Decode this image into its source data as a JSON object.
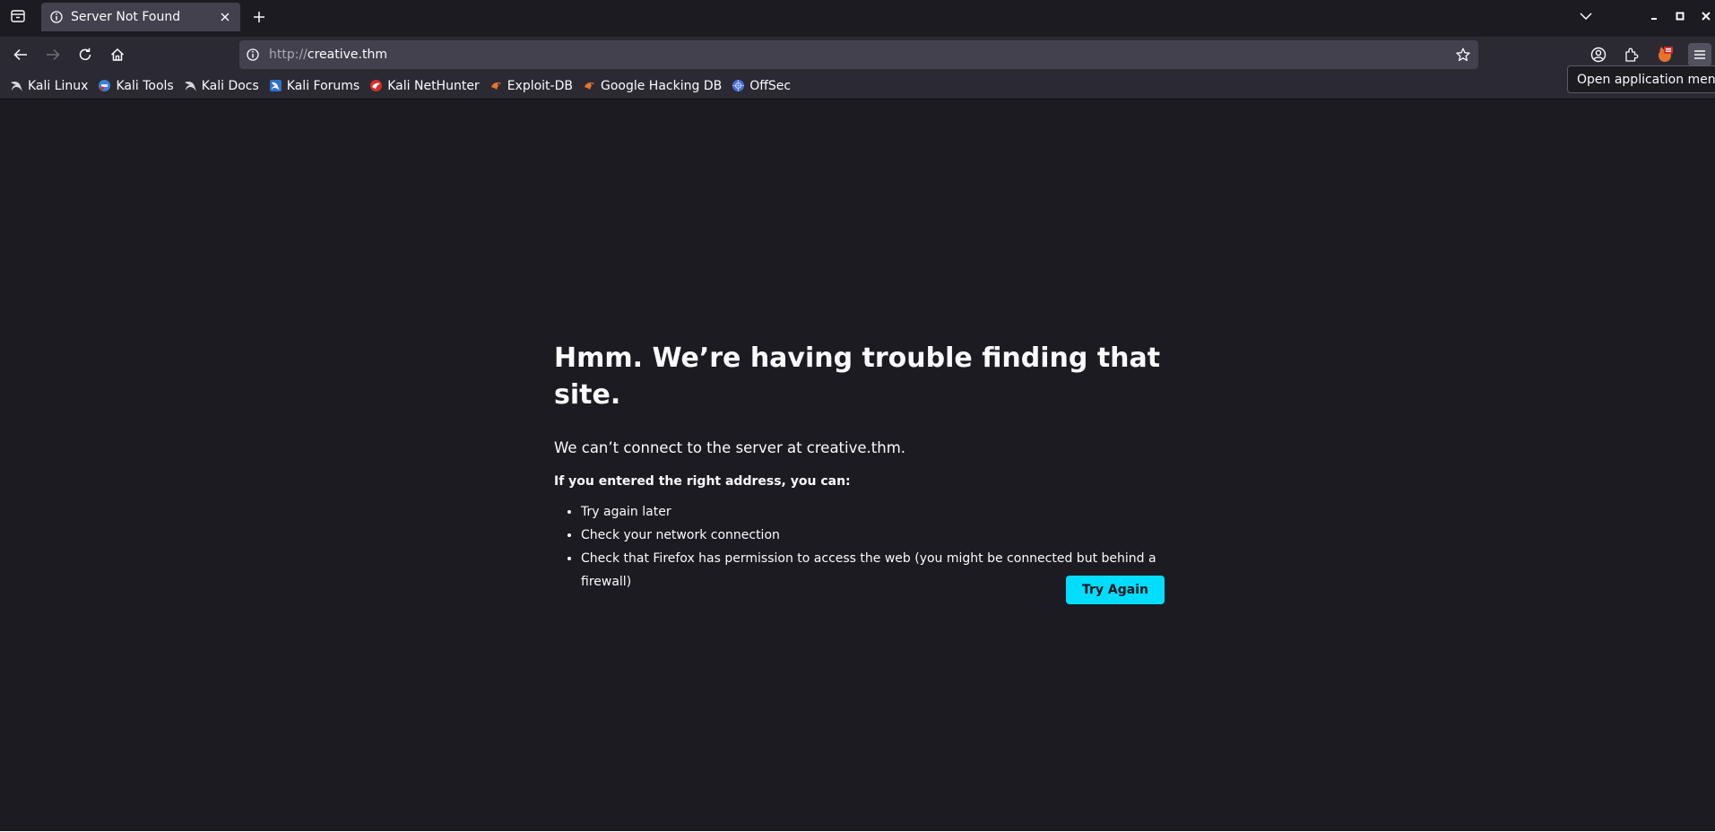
{
  "browser": {
    "tab": {
      "title": "Server Not Found"
    },
    "url": {
      "scheme": "http://",
      "host": "creative.thm"
    },
    "bookmarks": [
      {
        "label": "Kali Linux",
        "icon": "kali-dragon-icon"
      },
      {
        "label": "Kali Tools",
        "icon": "kali-tools-icon"
      },
      {
        "label": "Kali Docs",
        "icon": "kali-dragon-icon"
      },
      {
        "label": "Kali Forums",
        "icon": "kali-forums-icon"
      },
      {
        "label": "Kali NetHunter",
        "icon": "nethunter-icon"
      },
      {
        "label": "Exploit-DB",
        "icon": "exploit-db-icon"
      },
      {
        "label": "Google Hacking DB",
        "icon": "exploit-db-icon"
      },
      {
        "label": "OffSec",
        "icon": "offsec-icon"
      }
    ],
    "tooltip": "Open application menu"
  },
  "error_page": {
    "title": "Hmm. We’re having trouble finding that site.",
    "description": "We can’t connect to the server at creative.thm.",
    "hint": "If you entered the right address, you can:",
    "suggestions": [
      "Try again later",
      "Check your network connection",
      "Check that Firefox has permission to access the web (you might be connected but behind a firewall)"
    ],
    "button_label": "Try Again"
  },
  "colors": {
    "accent": "#00ddff",
    "background": "#1c1b22",
    "toolbar": "#2b2a33"
  }
}
